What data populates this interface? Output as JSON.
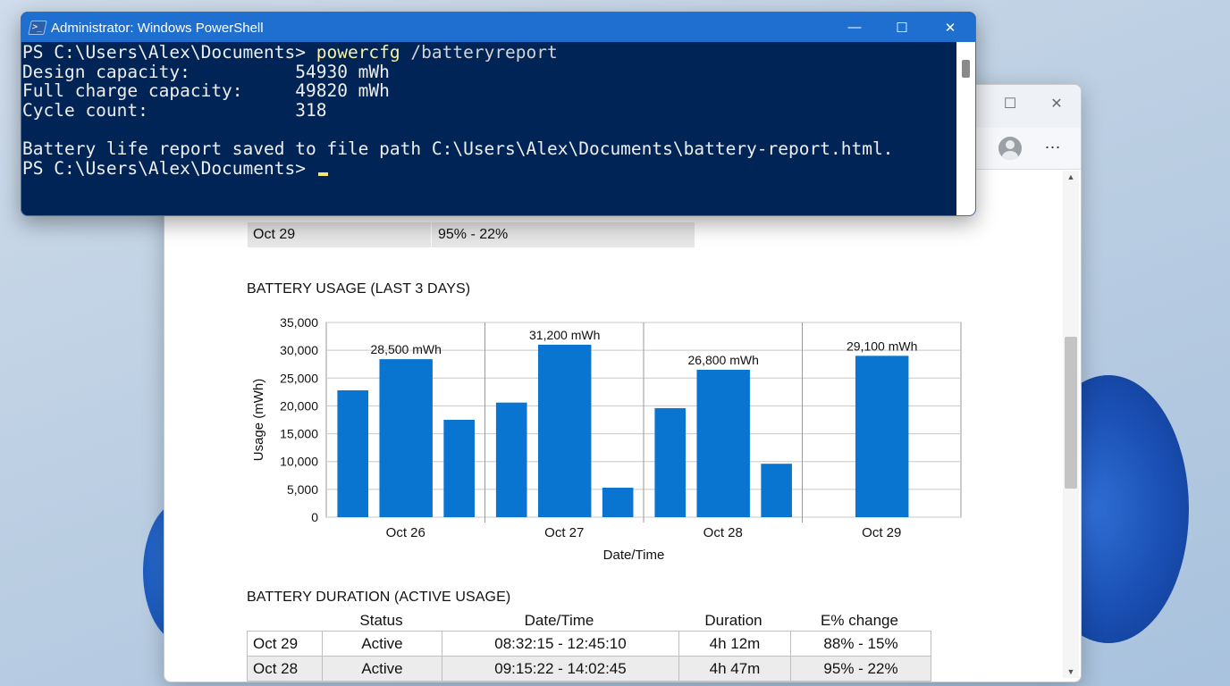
{
  "powershell": {
    "title": "Administrator: Windows PowerShell",
    "icon_label": ">_",
    "lines": [
      {
        "prompt": "PS C:\\Users\\Alex\\Documents> ",
        "command": "powercfg",
        "args": " /batteryreport"
      },
      {
        "text": "Design capacity:          54930 mWh"
      },
      {
        "text": "Full charge capacity:     49820 mWh"
      },
      {
        "text": "Cycle count:              318"
      },
      {
        "text": ""
      },
      {
        "text": "Battery life report saved to file path C:\\Users\\Alex\\Documents\\battery-report.html."
      },
      {
        "prompt": "PS C:\\Users\\Alex\\Documents> "
      }
    ],
    "controls": {
      "minimize": "—",
      "maximize": "☐",
      "close": "✕"
    }
  },
  "browser": {
    "controls": {
      "maximize": "☐",
      "close": "✕"
    },
    "more_menu": "⋯"
  },
  "report": {
    "top_row": {
      "date": "Oct 29",
      "capacity_change": "95% - 22%"
    },
    "usage_section_title": "BATTERY USAGE (LAST 3 DAYS)",
    "duration_section_title": "BATTERY DURATION (ACTIVE USAGE)",
    "duration_table": {
      "headers": [
        "Status",
        "Date/Time",
        "Duration",
        "E% change"
      ],
      "rows": [
        {
          "date": "Oct 29",
          "status": "Active",
          "datetime": "08:32:15 - 12:45:10",
          "duration": "4h 12m",
          "change": "88% - 15%"
        },
        {
          "date": "Oct 28",
          "status": "Active",
          "datetime": "09:15:22 - 14:02:45",
          "duration": "4h 47m",
          "change": "95% - 22%"
        }
      ]
    }
  },
  "chart_data": {
    "type": "bar",
    "title": "BATTERY USAGE (LAST 3 DAYS)",
    "xlabel": "Date/Time",
    "ylabel": "Usage (mWh)",
    "ylim": [
      0,
      35000
    ],
    "yticks": [
      "0",
      "5,000",
      "10,000",
      "15,000",
      "20,000",
      "25,000",
      "30,000",
      "35,000"
    ],
    "ytick_values": [
      0,
      5000,
      10000,
      15000,
      20000,
      25000,
      30000,
      35000
    ],
    "grid": true,
    "groups": [
      {
        "label": "Oct 26",
        "values": [
          22800,
          28400,
          17500
        ],
        "annotation": "28,500 mWh"
      },
      {
        "label": "Oct 27",
        "values": [
          20600,
          31000,
          5300
        ],
        "annotation": "31,200 mWh"
      },
      {
        "label": "Oct 28",
        "values": [
          19600,
          26500,
          9600
        ],
        "annotation": "26,800 mWh"
      },
      {
        "label": "Oct 29",
        "values": [
          29000
        ],
        "annotation": "29,100 mWh"
      }
    ],
    "bar_color": "#0a74d1"
  }
}
